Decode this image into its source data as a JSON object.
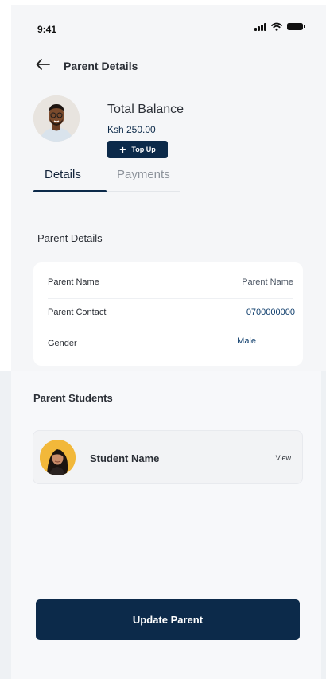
{
  "status_bar": {
    "time": "9:41"
  },
  "header": {
    "title": "Parent Details"
  },
  "balance": {
    "label": "Total Balance",
    "value": "Ksh 250.00",
    "topup_label": "Top Up"
  },
  "tabs": [
    {
      "label": "Details",
      "active": true
    },
    {
      "label": "Payments",
      "active": false
    }
  ],
  "parent_details": {
    "title": "Parent Details",
    "rows": [
      {
        "label": "Parent Name",
        "value": "Parent Name"
      },
      {
        "label": "Parent Contact",
        "value": "0700000000"
      },
      {
        "label": "Gender",
        "value": "Male"
      }
    ]
  },
  "parent_students": {
    "title": "Parent Students",
    "students": [
      {
        "name": "Student Name",
        "action": "View"
      }
    ]
  },
  "footer": {
    "update_label": "Update Parent"
  },
  "colors": {
    "primary": "#0c2a4a",
    "background": "#f5f6f8",
    "card": "#ffffff",
    "link": "#0d3c6b",
    "avatar_student_bg": "#f2b83a"
  },
  "icons": [
    "signal-icon",
    "wifi-icon",
    "battery-icon",
    "back-arrow-icon",
    "plus-icon"
  ]
}
